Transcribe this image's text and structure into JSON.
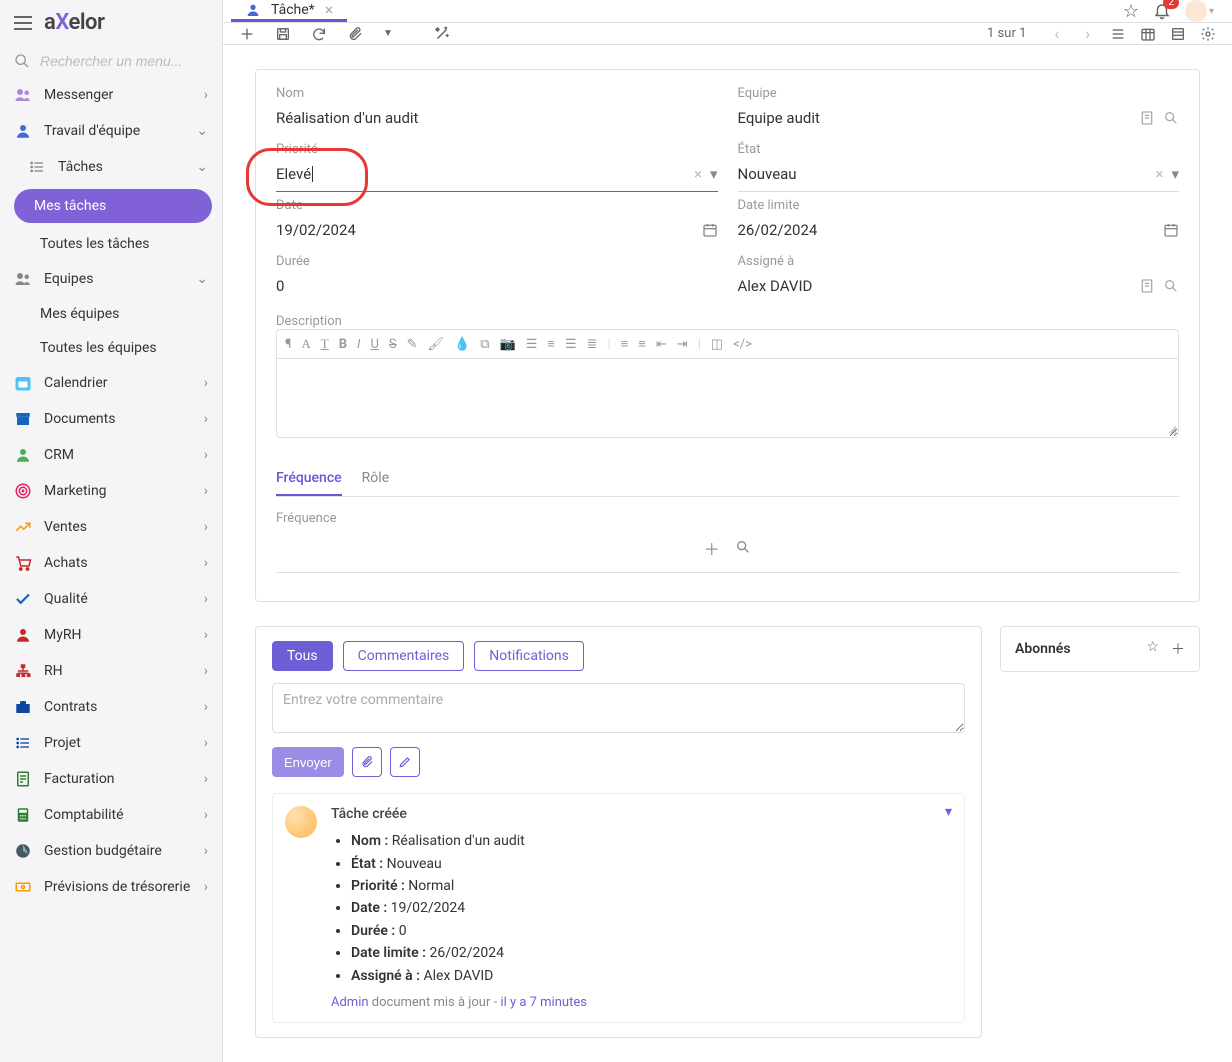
{
  "app_name": "axelor",
  "search_placeholder": "Rechercher un menu...",
  "sidebar": {
    "items": [
      {
        "label": "Messenger"
      },
      {
        "label": "Travail d'équipe"
      },
      {
        "label": "Tâches"
      },
      {
        "label": "Mes tâches"
      },
      {
        "label": "Toutes les tâches"
      },
      {
        "label": "Equipes"
      },
      {
        "label": "Mes équipes"
      },
      {
        "label": "Toutes les équipes"
      },
      {
        "label": "Calendrier"
      },
      {
        "label": "Documents"
      },
      {
        "label": "CRM"
      },
      {
        "label": "Marketing"
      },
      {
        "label": "Ventes"
      },
      {
        "label": "Achats"
      },
      {
        "label": "Qualité"
      },
      {
        "label": "MyRH"
      },
      {
        "label": "RH"
      },
      {
        "label": "Contrats"
      },
      {
        "label": "Projet"
      },
      {
        "label": "Facturation"
      },
      {
        "label": "Comptabilité"
      },
      {
        "label": "Gestion budgétaire"
      },
      {
        "label": "Prévisions de trésorerie"
      }
    ]
  },
  "tab": {
    "title": "Tâche*"
  },
  "notifications_count": "2",
  "toolbar": {
    "pager": "1 sur 1"
  },
  "form": {
    "nom_label": "Nom",
    "nom_value": "Réalisation d'un audit",
    "equipe_label": "Equipe",
    "equipe_value": "Equipe audit",
    "priorite_label": "Priorité",
    "priorite_value": "Elevé",
    "etat_label": "État",
    "etat_value": "Nouveau",
    "date_label": "Date",
    "date_value": "19/02/2024",
    "date_limite_label": "Date limite",
    "date_limite_value": "26/02/2024",
    "duree_label": "Durée",
    "duree_value": "0",
    "assigne_label": "Assigné à",
    "assigne_value": "Alex DAVID",
    "desc_label": "Description"
  },
  "subtabs": {
    "frequence": "Fréquence",
    "role": "Rôle",
    "freq_field_label": "Fréquence"
  },
  "comments": {
    "tab_all": "Tous",
    "tab_comments": "Commentaires",
    "tab_notifications": "Notifications",
    "placeholder": "Entrez votre commentaire",
    "send": "Envoyer"
  },
  "followers": {
    "title": "Abonnés"
  },
  "log": {
    "title": "Tâche créée",
    "items": [
      {
        "k": "Nom :",
        "v": "Réalisation d'un audit"
      },
      {
        "k": "État :",
        "v": "Nouveau"
      },
      {
        "k": "Priorité :",
        "v": "Normal"
      },
      {
        "k": "Date :",
        "v": "19/02/2024"
      },
      {
        "k": "Durée :",
        "v": "0"
      },
      {
        "k": "Date limite :",
        "v": "26/02/2024"
      },
      {
        "k": "Assigné à :",
        "v": "Alex DAVID"
      }
    ],
    "admin": "Admin",
    "meta": "document mis à jour -",
    "time": "il y a 7 minutes"
  }
}
